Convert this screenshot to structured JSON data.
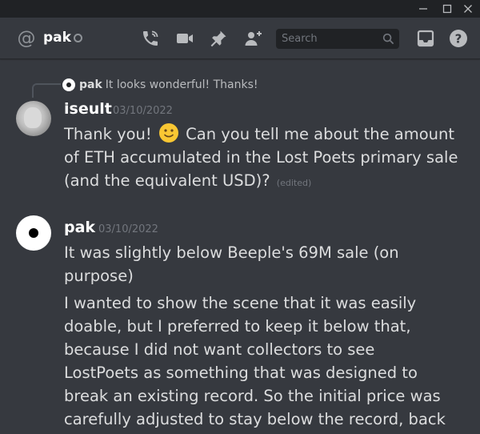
{
  "window": {
    "controls": {
      "minimize": "–",
      "maximize": "☐",
      "close": "✕"
    }
  },
  "header": {
    "channel_icon": "at-icon",
    "name": "pak",
    "status": "offline",
    "icons": [
      "phone-call-icon",
      "video-camera-icon",
      "pin-icon",
      "add-friend-icon",
      "inbox-icon",
      "help-icon"
    ],
    "search_placeholder": "Search"
  },
  "colors": {
    "background": "#36393f",
    "titlebar": "#202225",
    "search_bg": "#202225",
    "author": "#ffffff",
    "text": "#dcddde",
    "muted": "#72767d",
    "emoji": "#f9c733"
  },
  "messages": [
    {
      "reply_to": {
        "author": "pak",
        "text": "It looks wonderful! Thanks!"
      },
      "author": "iseult",
      "timestamp": "03/10/2022",
      "paragraphs": [
        {
          "before_emoji": "Thank you!",
          "emoji": "slightly-smiling-face",
          "after_emoji": "Can you tell me about the amount of ETH accumulated in the Lost Poets primary sale (and the equivalent USD)?",
          "edited": "(edited)"
        }
      ]
    },
    {
      "author": "pak",
      "timestamp": "03/10/2022",
      "paragraphs": [
        "It was slightly below Beeple's 69M sale (on purpose)",
        "I wanted to show the scene that it was easily doable, but I preferred to keep it below that, because I did not want collectors to see LostPoets as something that was designed to break an existing record. So the initial price was carefully adjusted to stay below the record, back in the day."
      ]
    }
  ]
}
